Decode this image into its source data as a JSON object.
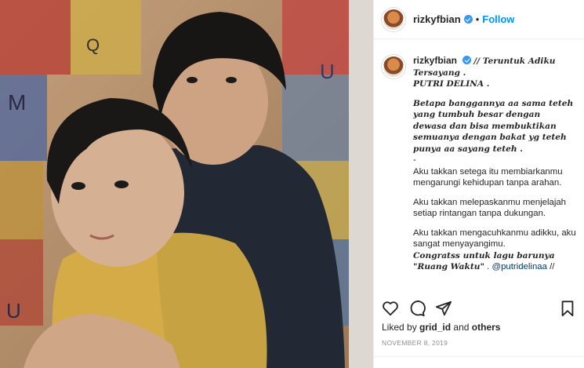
{
  "post": {
    "username": "rizkyfbian",
    "separator": "•",
    "follow_label": "Follow",
    "caption": {
      "username": "rizkyfbian",
      "lines_serif_1": [
        "// Teruntuk Adiku Tersayang .",
        "PUTRI DELINA ."
      ],
      "lines_serif_2": [
        "Betapa banggannya aa sama teteh yang tumbuh besar dengan dewasa dan bisa membuktikan semuanya dengan bakat yg teteh punya aa sayang teteh ."
      ],
      "dash": "-",
      "para_1": "Aku takkan setega itu membiarkanmu mengarungi kehidupan tanpa arahan.",
      "para_2": "Aku takkan melepaskanmu menjelajah setiap rintangan tanpa dukungan.",
      "para_3": "Aku takkan mengacuhkanmu adikku, aku sangat menyayangimu.",
      "congrats": "Congratss untuk lagu barunya \"Ruang Waktu\"",
      "mention_dot": ".",
      "mention": "@putridelinaa",
      "mention_tail": "//"
    },
    "liked_by_prefix": "Liked by",
    "liked_by_user": "grid_id",
    "liked_by_and": "and",
    "liked_by_others": "others",
    "date": "NOVEMBER 8, 2019"
  },
  "icons": {
    "like": "heart-icon",
    "comment": "comment-icon",
    "share": "share-icon",
    "save": "bookmark-icon",
    "verified": "verified-badge-icon"
  },
  "colors": {
    "accent": "#0095f6",
    "verified": "#3897f0",
    "muted": "#8e8e8e"
  }
}
